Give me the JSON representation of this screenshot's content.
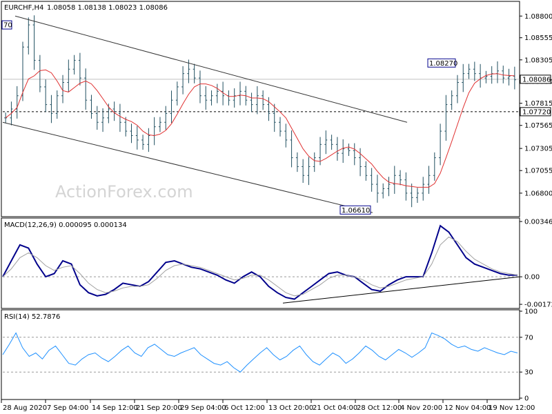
{
  "header": {
    "symbol": "EURCHF,H4",
    "ohlc": "1.08058 1.08138 1.08023 1.08086"
  },
  "watermark": "ActionForex.com",
  "colors": {
    "price_bars": "#1f4e5f",
    "sma": "#e03030",
    "macd": "#00008b",
    "macd_signal": "#a0a0a0",
    "rsi": "#1e90ff",
    "channel": "#333333",
    "grid_dash": "#999999"
  },
  "chart_data": [
    {
      "type": "ohlc",
      "name": "price",
      "title": "EURCHF,H4",
      "ylim": [
        1.0655,
        1.0895
      ],
      "y_ticks": [
        "1.08800",
        "1.08555",
        "1.08305",
        "1.08060",
        "1.07815",
        "1.07565",
        "1.07305",
        "1.07055",
        "1.06800"
      ],
      "y_tick_values": [
        1.088,
        1.08555,
        1.08305,
        1.0806,
        1.07815,
        1.07565,
        1.07305,
        1.07055,
        1.068
      ],
      "x_ticks": [
        "28 Aug 2020",
        "7 Sep 04:00",
        "14 Sep 12:00",
        "21 Sep 20:00",
        "29 Sep 04:00",
        "6 Oct 12:00",
        "13 Oct 20:00",
        "21 Oct 04:00",
        "28 Oct 12:00",
        "4 Nov 20:00",
        "12 Nov 04:00",
        "19 Nov 12:00"
      ],
      "current_price": 1.08086,
      "current_price_label": "1.08086",
      "level": 1.0772,
      "level_label": "1.07720",
      "annotations": [
        {
          "text": "70",
          "value": 1.087
        },
        {
          "text": "1.08270",
          "value": 1.0827
        },
        {
          "text": "1.06610",
          "value": 1.0661
        }
      ],
      "closes": [
        1.0765,
        1.0775,
        1.079,
        1.0845,
        1.087,
        1.083,
        1.08,
        1.078,
        1.077,
        1.079,
        1.0805,
        1.082,
        1.083,
        1.081,
        1.0785,
        1.077,
        1.076,
        1.0765,
        1.0775,
        1.077,
        1.076,
        1.075,
        1.0745,
        1.074,
        1.0735,
        1.0745,
        1.0755,
        1.076,
        1.077,
        1.0785,
        1.08,
        1.0815,
        1.082,
        1.081,
        1.079,
        1.0785,
        1.079,
        1.0795,
        1.079,
        1.0785,
        1.079,
        1.0795,
        1.0785,
        1.078,
        1.079,
        1.078,
        1.077,
        1.076,
        1.075,
        1.074,
        1.072,
        1.071,
        1.07,
        1.071,
        1.072,
        1.0735,
        1.074,
        1.0735,
        1.0725,
        1.073,
        1.0728,
        1.072,
        1.071,
        1.07,
        1.069,
        1.068,
        1.0685,
        1.069,
        1.07,
        1.0695,
        1.068,
        1.0675,
        1.068,
        1.069,
        1.07,
        1.072,
        1.075,
        1.078,
        1.079,
        1.0805,
        1.0815,
        1.082,
        1.0815,
        1.081,
        1.0812,
        1.0815,
        1.0818,
        1.081,
        1.0812,
        1.0808
      ]
    },
    {
      "type": "line",
      "name": "MACD(12,26,9)",
      "title": "MACD(12,26,9) 0.000095 0.000134",
      "ylim": [
        -0.0019,
        0.0036
      ],
      "y_ticks": [
        "0.003469",
        "0.00",
        "-0.001729"
      ],
      "y_tick_values": [
        0.003469,
        0.0,
        -0.001729
      ],
      "series": [
        {
          "name": "MACD",
          "values": [
            0.0,
            0.001,
            0.002,
            0.0018,
            0.0008,
            0.0,
            0.0002,
            0.001,
            0.0008,
            -0.0005,
            -0.001,
            -0.0012,
            -0.0011,
            -0.0008,
            -0.0004,
            -0.0005,
            -0.0006,
            -0.0003,
            0.0003,
            0.0009,
            0.001,
            0.0008,
            0.0006,
            0.0005,
            0.0003,
            0.0001,
            -0.0002,
            -0.0004,
            0.0,
            0.0003,
            0.0,
            -0.0006,
            -0.001,
            -0.0013,
            -0.0014,
            -0.001,
            -0.0006,
            -0.0002,
            0.0002,
            0.0003,
            0.0001,
            0.0,
            -0.0004,
            -0.0008,
            -0.0009,
            -0.0005,
            -0.0002,
            0.0,
            0.0,
            0.0,
            0.0015,
            0.0032,
            0.0028,
            0.002,
            0.0012,
            0.0008,
            0.0006,
            0.0004,
            0.0002,
            0.0001,
            0.0001
          ]
        },
        {
          "name": "Signal",
          "values": [
            0.0,
            0.0005,
            0.0012,
            0.0015,
            0.0012,
            0.0007,
            0.0004,
            0.0006,
            0.0007,
            0.0002,
            -0.0004,
            -0.0008,
            -0.001,
            -0.0009,
            -0.0007,
            -0.0006,
            -0.0006,
            -0.0005,
            -0.0001,
            0.0004,
            0.0007,
            0.0008,
            0.0007,
            0.0006,
            0.0004,
            0.0002,
            0.0,
            -0.0002,
            -0.0001,
            0.0001,
            0.0001,
            -0.0002,
            -0.0006,
            -0.001,
            -0.0012,
            -0.0011,
            -0.0008,
            -0.0005,
            -0.0001,
            0.0001,
            0.0001,
            0.0,
            -0.0002,
            -0.0005,
            -0.0007,
            -0.0006,
            -0.0004,
            -0.0002,
            -0.0001,
            0.0,
            0.0008,
            0.002,
            0.0025,
            0.0022,
            0.0016,
            0.0011,
            0.0008,
            0.0005,
            0.0003,
            0.0002,
            0.0001
          ]
        }
      ],
      "trendline": {
        "from": -0.00165,
        "to": 0.0
      }
    },
    {
      "type": "line",
      "name": "RSI(14)",
      "title": "RSI(14) 52.7876",
      "ylim": [
        0,
        100
      ],
      "y_ticks": [
        "100",
        "70",
        "30",
        "0"
      ],
      "y_tick_values": [
        100,
        70,
        30,
        0
      ],
      "levels": [
        70,
        30
      ],
      "series": [
        {
          "name": "RSI",
          "values": [
            50,
            62,
            75,
            58,
            48,
            52,
            45,
            55,
            60,
            50,
            40,
            38,
            45,
            50,
            52,
            46,
            42,
            48,
            55,
            60,
            52,
            48,
            58,
            62,
            56,
            50,
            48,
            52,
            55,
            58,
            50,
            45,
            40,
            38,
            42,
            35,
            30,
            38,
            45,
            52,
            58,
            50,
            44,
            48,
            55,
            60,
            50,
            42,
            38,
            45,
            52,
            48,
            40,
            45,
            52,
            60,
            55,
            48,
            44,
            50,
            56,
            52,
            47,
            52,
            58,
            75,
            72,
            68,
            62,
            58,
            60,
            56,
            54,
            58,
            55,
            52,
            50,
            54,
            52
          ]
        }
      ]
    }
  ],
  "x_axis": [
    "28 Aug 2020",
    "7 Sep 04:00",
    "14 Sep 12:00",
    "21 Sep 20:00",
    "29 Sep 04:00",
    "6 Oct 12:00",
    "13 Oct 20:00",
    "21 Oct 04:00",
    "28 Oct 12:00",
    "4 Nov 20:00",
    "12 Nov 04:00",
    "19 Nov 12:00"
  ]
}
